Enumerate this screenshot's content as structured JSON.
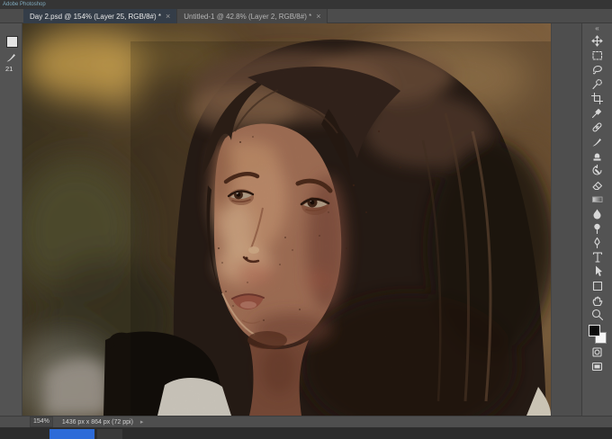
{
  "window": {
    "title_fragment": "Adobe Photoshop"
  },
  "tabs": [
    {
      "label": "Day 2.psd @ 154% (Layer 25, RGB/8#) *",
      "close_glyph": "×",
      "active": true
    },
    {
      "label": "Untitled-1 @ 42.8% (Layer 2, RGB/8#) *",
      "close_glyph": "×",
      "active": false
    }
  ],
  "left_panel": {
    "brush_size": "21",
    "icons": [
      "white-swatch-icon",
      "brush-icon"
    ]
  },
  "toolbar": {
    "collapse_glyph": "«",
    "tools": [
      "move",
      "rectangular-marquee",
      "lasso",
      "quick-selection",
      "crop",
      "eyedropper",
      "spot-healing",
      "brush",
      "clone-stamp",
      "history-brush",
      "eraser",
      "gradient",
      "blur",
      "dodge",
      "pen",
      "type",
      "path-selection",
      "shape",
      "hand",
      "zoom"
    ],
    "foreground_color": "#0b0b0b",
    "background_color": "#f5f5f5",
    "extra_icons": [
      "quick-mask-icon",
      "screen-mode-icon"
    ]
  },
  "status_bar": {
    "zoom": "154%",
    "doc_info": "1436 px x 864 px (72 ppi)",
    "chevron_glyph": "▸"
  },
  "taskbar": {
    "accent_color": "#2d6bd8"
  },
  "canvas": {
    "description": "Digital painting: young woman with long brown hair gazing up-left, warm blurred interior background, dark brushstroke and white shirt at bottom left"
  }
}
